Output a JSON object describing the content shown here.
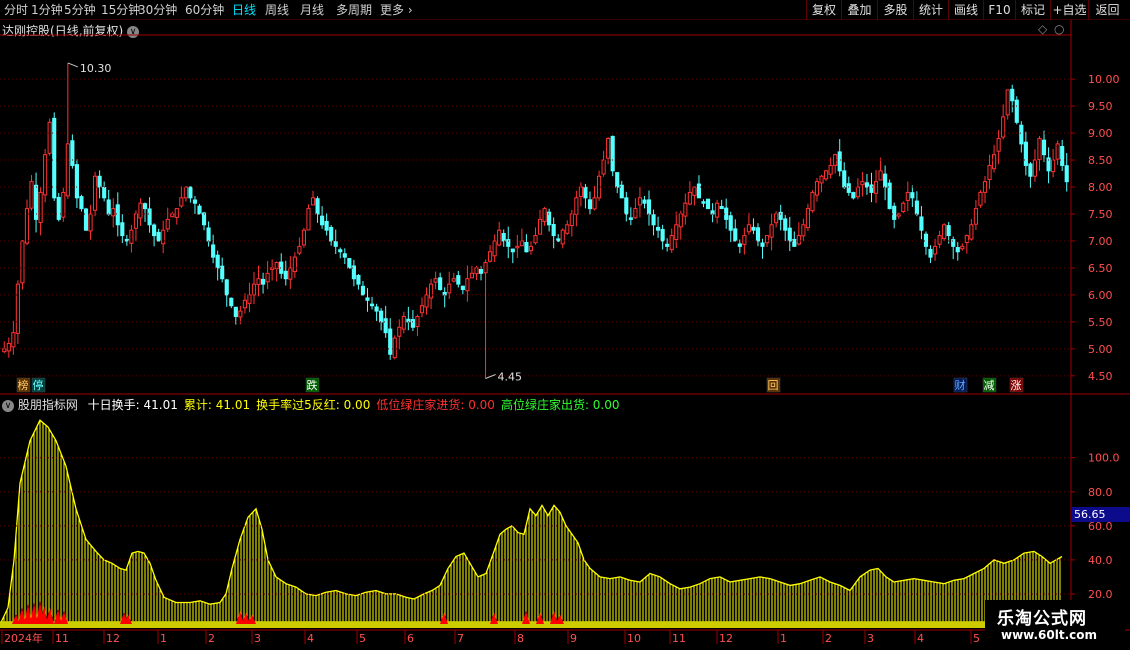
{
  "toolbar": {
    "left_items": [
      "分时",
      "1分钟",
      "5分钟",
      "15分钟",
      "30分钟",
      "60分钟",
      "日线",
      "周线",
      "月线",
      "多周期",
      "更多"
    ],
    "active_index": 6,
    "right_items": [
      "复权",
      "叠加",
      "多股",
      "统计",
      "画线",
      "F10",
      "标记",
      "+自选",
      "返回"
    ]
  },
  "main_header": {
    "stock_name": "达刚控股",
    "period_info": "(日线,前复权)",
    "max_marker": "10.30",
    "min_marker": "4.45"
  },
  "event_tags": [
    {
      "text": "榜",
      "color": "#ffcc66",
      "bg": "#5a3000"
    },
    {
      "text": "停",
      "color": "#66ffff",
      "bg": "#004040"
    },
    {
      "text": "跌",
      "color": "#ffffff",
      "bg": "#006000"
    },
    {
      "text": "回",
      "color": "#ffcc66",
      "bg": "#5a3000"
    },
    {
      "text": "财",
      "color": "#66aaff",
      "bg": "#001a5a"
    },
    {
      "text": "减",
      "color": "#ffffff",
      "bg": "#006000"
    },
    {
      "text": "涨",
      "color": "#ffffff",
      "bg": "#800000"
    }
  ],
  "sub_header": {
    "indicator_name": "股朋指标网",
    "items": [
      {
        "label": "十日换手:",
        "value": "41.01",
        "color": "#ffffff"
      },
      {
        "label": "累计:",
        "value": "41.01",
        "color": "#ffff00"
      },
      {
        "label": "换手率过5反红:",
        "value": "0.00",
        "color": "#ffff00"
      },
      {
        "label": "低位绿庄家进货:",
        "value": "0.00",
        "color": "#ff3030"
      },
      {
        "label": "高位绿庄家出货:",
        "value": "0.00",
        "color": "#30ff30"
      }
    ]
  },
  "current_value_box": "56.65",
  "x_axis": {
    "labels": [
      "2024年",
      "11",
      "12",
      "1",
      "2",
      "3",
      "4",
      "5",
      "6",
      "7",
      "8",
      "9",
      "10",
      "11",
      "12",
      "1",
      "2",
      "3",
      "4",
      "5"
    ]
  },
  "watermark": {
    "title": "乐淘公式网",
    "url": "www.60lt.com"
  },
  "colors": {
    "up": "#ff3232",
    "down": "#54ffff",
    "grid": "#5a0000",
    "axis": "#a00000",
    "volume": "#ffff00",
    "volume_fill": "#cccc00",
    "signal": "#ff0000"
  },
  "chart_data": [
    {
      "type": "candlestick",
      "title": "达刚控股(日线,前复权)",
      "y_ticks": [
        4.5,
        5.0,
        5.5,
        6.0,
        6.5,
        7.0,
        7.5,
        8.0,
        8.5,
        9.0,
        9.5,
        10.0
      ],
      "ylim": [
        4.2,
        10.8
      ],
      "max_point": {
        "index": 14,
        "value": 10.3
      },
      "min_point": {
        "index": 106,
        "value": 4.45
      },
      "closes": [
        5.0,
        5.1,
        5.3,
        6.2,
        7.0,
        7.6,
        8.1,
        7.4,
        7.9,
        8.6,
        9.2,
        7.8,
        7.4,
        7.9,
        8.8,
        8.4,
        7.8,
        7.6,
        7.2,
        7.5,
        8.2,
        8.0,
        7.8,
        7.5,
        7.6,
        7.3,
        7.1,
        7.0,
        7.2,
        7.5,
        7.7,
        7.6,
        7.3,
        7.1,
        7.0,
        7.2,
        7.4,
        7.5,
        7.6,
        7.8,
        8.0,
        7.8,
        7.7,
        7.5,
        7.3,
        7.0,
        6.7,
        6.5,
        6.3,
        6.0,
        5.8,
        5.6,
        5.7,
        5.9,
        6.0,
        6.2,
        6.3,
        6.2,
        6.4,
        6.5,
        6.6,
        6.4,
        6.3,
        6.5,
        6.7,
        6.9,
        7.2,
        7.6,
        7.8,
        7.5,
        7.3,
        7.2,
        7.0,
        6.9,
        6.8,
        6.7,
        6.5,
        6.3,
        6.2,
        6.0,
        5.9,
        5.8,
        5.7,
        5.5,
        5.3,
        4.9,
        5.2,
        5.4,
        5.6,
        5.5,
        5.4,
        5.6,
        5.8,
        6.0,
        6.2,
        6.3,
        6.1,
        6.0,
        6.2,
        6.3,
        6.2,
        6.1,
        6.3,
        6.4,
        6.5,
        6.4,
        6.6,
        6.8,
        7.0,
        7.2,
        7.0,
        6.9,
        6.8,
        6.9,
        7.0,
        6.8,
        6.9,
        7.1,
        7.4,
        7.6,
        7.3,
        7.1,
        7.0,
        7.2,
        7.3,
        7.5,
        7.8,
        8.0,
        7.8,
        7.6,
        7.8,
        8.2,
        8.5,
        8.9,
        8.3,
        8.0,
        7.8,
        7.5,
        7.4,
        7.6,
        7.8,
        7.7,
        7.5,
        7.3,
        7.2,
        7.0,
        6.9,
        7.1,
        7.3,
        7.5,
        7.7,
        7.9,
        8.0,
        7.8,
        7.7,
        7.6,
        7.5,
        7.7,
        7.6,
        7.4,
        7.2,
        7.0,
        6.9,
        7.1,
        7.3,
        7.2,
        7.0,
        6.9,
        7.1,
        7.3,
        7.5,
        7.4,
        7.2,
        7.0,
        6.9,
        7.1,
        7.3,
        7.6,
        7.9,
        8.1,
        8.2,
        8.3,
        8.4,
        8.6,
        8.3,
        8.0,
        7.9,
        7.8,
        8.0,
        8.1,
        8.0,
        7.9,
        8.1,
        8.3,
        8.0,
        7.6,
        7.4,
        7.5,
        7.7,
        7.9,
        7.8,
        7.5,
        7.2,
        6.9,
        6.7,
        6.9,
        7.1,
        7.3,
        7.1,
        6.9,
        6.8,
        6.9,
        7.1,
        7.3,
        7.6,
        7.9,
        8.1,
        8.4,
        8.6,
        8.9,
        9.3,
        9.8,
        9.6,
        9.2,
        8.8,
        8.4,
        8.2,
        8.5,
        8.9,
        8.6,
        8.3,
        8.5,
        8.8,
        8.4,
        8.1
      ]
    },
    {
      "type": "bar",
      "title": "股朋指标网",
      "y_ticks": [
        20.0,
        40.0,
        60.0,
        80.0,
        100.0
      ],
      "ylim": [
        0,
        128
      ],
      "current": 56.65,
      "turnover_envelope": [
        [
          0,
          2
        ],
        [
          8,
          12
        ],
        [
          14,
          40
        ],
        [
          20,
          85
        ],
        [
          30,
          110
        ],
        [
          40,
          122
        ],
        [
          48,
          118
        ],
        [
          56,
          110
        ],
        [
          66,
          95
        ],
        [
          76,
          70
        ],
        [
          86,
          52
        ],
        [
          96,
          45
        ],
        [
          104,
          40
        ],
        [
          112,
          38
        ],
        [
          120,
          35
        ],
        [
          126,
          34
        ],
        [
          132,
          44
        ],
        [
          138,
          45
        ],
        [
          144,
          44
        ],
        [
          150,
          38
        ],
        [
          156,
          28
        ],
        [
          164,
          18
        ],
        [
          176,
          15
        ],
        [
          190,
          15
        ],
        [
          200,
          16
        ],
        [
          210,
          14
        ],
        [
          220,
          15
        ],
        [
          226,
          20
        ],
        [
          232,
          35
        ],
        [
          240,
          52
        ],
        [
          248,
          65
        ],
        [
          256,
          70
        ],
        [
          262,
          58
        ],
        [
          268,
          40
        ],
        [
          276,
          30
        ],
        [
          286,
          26
        ],
        [
          296,
          24
        ],
        [
          306,
          20
        ],
        [
          316,
          19
        ],
        [
          326,
          21
        ],
        [
          336,
          22
        ],
        [
          346,
          20
        ],
        [
          356,
          19
        ],
        [
          366,
          21
        ],
        [
          376,
          22
        ],
        [
          386,
          20
        ],
        [
          396,
          20
        ],
        [
          406,
          18
        ],
        [
          414,
          17
        ],
        [
          424,
          20
        ],
        [
          432,
          22
        ],
        [
          440,
          25
        ],
        [
          448,
          35
        ],
        [
          456,
          42
        ],
        [
          464,
          44
        ],
        [
          470,
          38
        ],
        [
          478,
          30
        ],
        [
          486,
          32
        ],
        [
          494,
          45
        ],
        [
          500,
          55
        ],
        [
          506,
          58
        ],
        [
          512,
          60
        ],
        [
          518,
          56
        ],
        [
          524,
          55
        ],
        [
          530,
          70
        ],
        [
          536,
          66
        ],
        [
          542,
          72
        ],
        [
          548,
          66
        ],
        [
          554,
          72
        ],
        [
          560,
          68
        ],
        [
          566,
          60
        ],
        [
          572,
          55
        ],
        [
          578,
          50
        ],
        [
          584,
          40
        ],
        [
          590,
          35
        ],
        [
          600,
          30
        ],
        [
          610,
          29
        ],
        [
          620,
          30
        ],
        [
          630,
          28
        ],
        [
          640,
          27
        ],
        [
          650,
          32
        ],
        [
          660,
          30
        ],
        [
          670,
          26
        ],
        [
          680,
          23
        ],
        [
          690,
          24
        ],
        [
          700,
          26
        ],
        [
          710,
          29
        ],
        [
          720,
          30
        ],
        [
          730,
          27
        ],
        [
          740,
          28
        ],
        [
          750,
          29
        ],
        [
          760,
          30
        ],
        [
          770,
          29
        ],
        [
          780,
          27
        ],
        [
          790,
          25
        ],
        [
          800,
          26
        ],
        [
          810,
          28
        ],
        [
          820,
          30
        ],
        [
          830,
          27
        ],
        [
          840,
          25
        ],
        [
          850,
          22
        ],
        [
          860,
          30
        ],
        [
          870,
          34
        ],
        [
          878,
          35
        ],
        [
          886,
          30
        ],
        [
          894,
          27
        ],
        [
          904,
          28
        ],
        [
          914,
          29
        ],
        [
          924,
          28
        ],
        [
          934,
          27
        ],
        [
          944,
          26
        ],
        [
          954,
          28
        ],
        [
          964,
          29
        ],
        [
          974,
          32
        ],
        [
          984,
          35
        ],
        [
          994,
          40
        ],
        [
          1004,
          38
        ],
        [
          1014,
          40
        ],
        [
          1024,
          44
        ],
        [
          1034,
          45
        ],
        [
          1042,
          42
        ],
        [
          1050,
          38
        ],
        [
          1056,
          40
        ],
        [
          1062,
          42
        ]
      ],
      "signal_spikes": [
        [
          16,
          4
        ],
        [
          22,
          8
        ],
        [
          28,
          10
        ],
        [
          34,
          11
        ],
        [
          40,
          12
        ],
        [
          44,
          9
        ],
        [
          50,
          8
        ],
        [
          58,
          7
        ],
        [
          64,
          6
        ],
        [
          124,
          5
        ],
        [
          128,
          4
        ],
        [
          240,
          6
        ],
        [
          246,
          5
        ],
        [
          252,
          4
        ],
        [
          444,
          5
        ],
        [
          494,
          5
        ],
        [
          526,
          6
        ],
        [
          540,
          5
        ],
        [
          554,
          6
        ],
        [
          560,
          4
        ]
      ],
      "baseline_band": 4
    }
  ]
}
